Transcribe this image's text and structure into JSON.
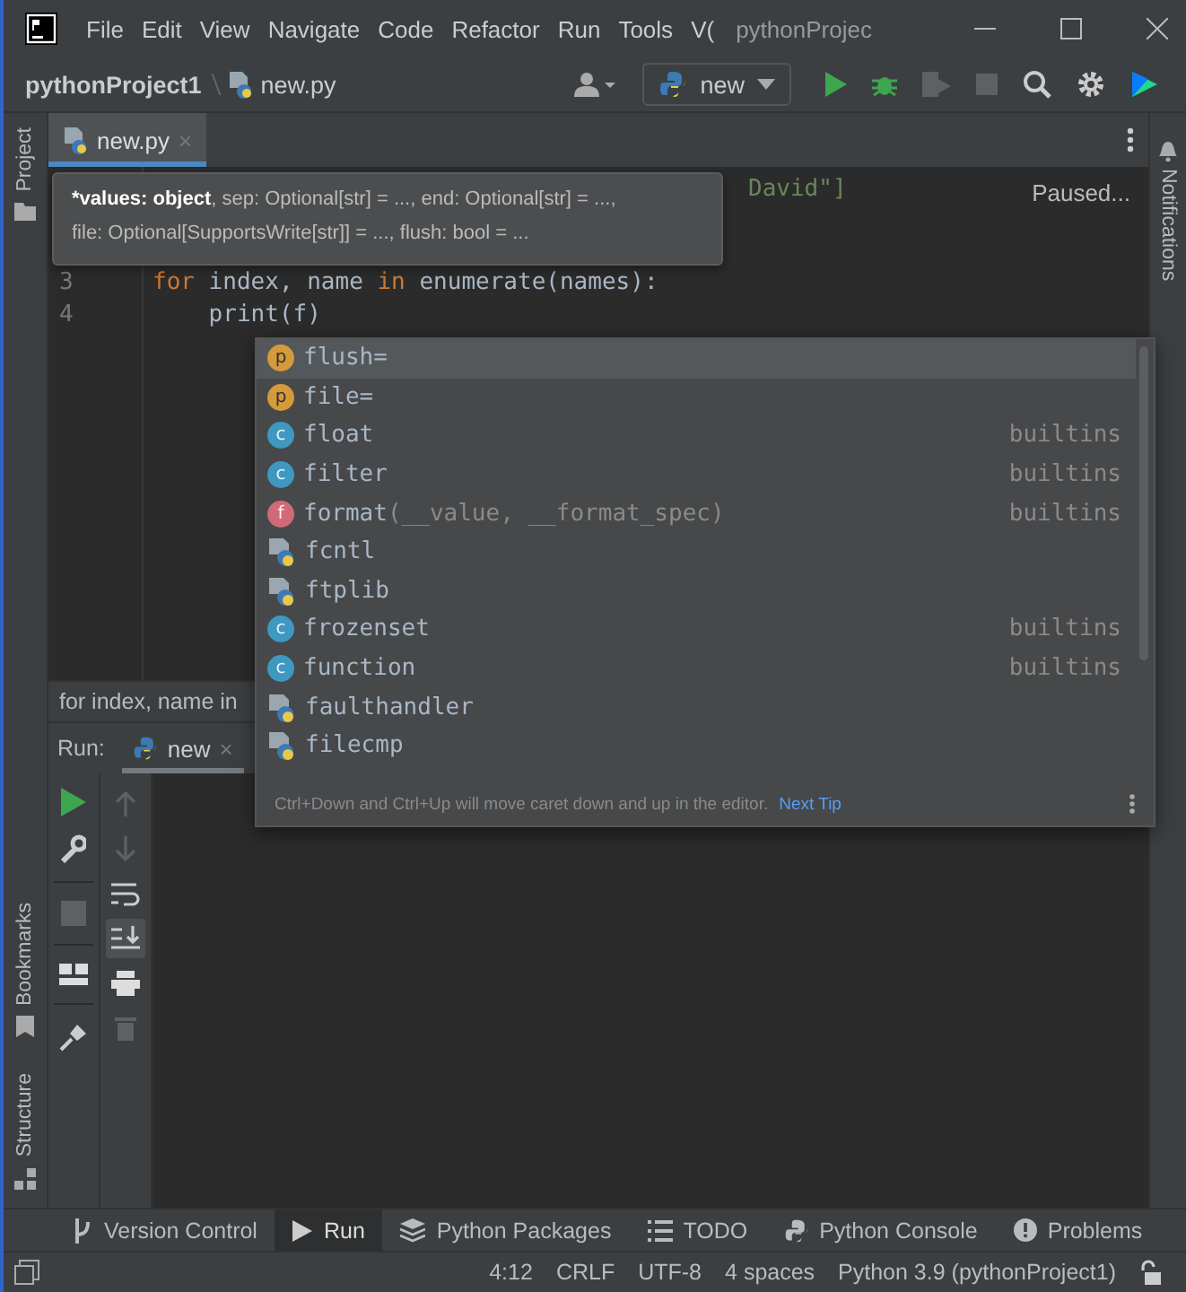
{
  "menu": {
    "items": [
      "File",
      "Edit",
      "View",
      "Navigate",
      "Code",
      "Refactor",
      "Run",
      "Tools",
      "V("
    ]
  },
  "window": {
    "title": "pythonProjec"
  },
  "breadcrumb": [
    "pythonProject1",
    "new.py"
  ],
  "run_config": {
    "label": "new"
  },
  "toolbar": [
    {
      "kind": "run",
      "disabled": false
    },
    {
      "kind": "debug",
      "disabled": false
    },
    {
      "kind": "coverage",
      "disabled": true
    },
    {
      "kind": "stop",
      "disabled": true
    }
  ],
  "left_strip": {
    "top": "Project",
    "bottom": [
      "Bookmarks",
      "Structure"
    ]
  },
  "right_strip": {
    "label": "Notifications"
  },
  "editor_tabs": [
    {
      "label": "new.py",
      "close": "×",
      "selected": true
    }
  ],
  "editor": {
    "status": "Paused...",
    "lines": [
      {
        "segments": [
          {
            "text": "David\"]",
            "kind": "string"
          }
        ]
      },
      {
        "number": "3",
        "segments": [
          {
            "text": "for",
            "kind": "keyword"
          },
          {
            "text": " index, name ",
            "kind": "plain"
          },
          {
            "text": "in",
            "kind": "keyword"
          },
          {
            "text": " enumerate(names):",
            "kind": "plain"
          }
        ]
      },
      {
        "number": "4",
        "segments": [
          {
            "text": "    print(f)",
            "kind": "plain"
          }
        ]
      }
    ],
    "breadcrumb": "for index, name in"
  },
  "tooltip": {
    "lines": [
      [
        {
          "text": "*values: object",
          "bold": true
        },
        {
          "text": ", sep: Optional[str] = ..., end: Optional[str] = ...,",
          "bold": false
        }
      ],
      [
        {
          "text": "file: Optional[SupportsWrite[str]] = ..., flush: bool = ...",
          "bold": false
        }
      ]
    ]
  },
  "completion": {
    "items": [
      {
        "kind": "parameter",
        "letter": "p",
        "name": "flush=",
        "selected": true
      },
      {
        "kind": "parameter",
        "letter": "p",
        "name": "file=",
        "selected": false
      },
      {
        "kind": "class",
        "letter": "c",
        "name": "float",
        "source": "builtins",
        "selected": false
      },
      {
        "kind": "class",
        "letter": "c",
        "name": "filter",
        "source": "builtins",
        "selected": false
      },
      {
        "kind": "function",
        "letter": "f",
        "name": "format",
        "args": "(__value, __format_spec)",
        "source": "builtins",
        "selected": false
      },
      {
        "kind": "module",
        "name": "fcntl",
        "selected": false
      },
      {
        "kind": "module",
        "name": "ftplib",
        "selected": false
      },
      {
        "kind": "class",
        "letter": "c",
        "name": "frozenset",
        "source": "builtins",
        "selected": false
      },
      {
        "kind": "class",
        "letter": "c",
        "name": "function",
        "source": "builtins",
        "selected": false
      },
      {
        "kind": "module",
        "name": "faulthandler",
        "selected": false
      },
      {
        "kind": "module",
        "name": "filecmp",
        "selected": false
      }
    ],
    "hint": "Ctrl+Down and Ctrl+Up will move caret down and up in the editor.",
    "hint_link": "Next Tip"
  },
  "run_panel": {
    "title": "Run:",
    "tab": "new",
    "close": "×",
    "left_tools": [
      {
        "kind": "run",
        "disabled": false
      },
      {
        "kind": "wrench",
        "disabled": false
      },
      {
        "kind": "stop",
        "disabled": true
      },
      {
        "kind": "layout",
        "disabled": false
      },
      {
        "kind": "pin",
        "disabled": false
      }
    ],
    "right_tools": [
      {
        "kind": "up",
        "disabled": true,
        "selected": false
      },
      {
        "kind": "down",
        "disabled": true,
        "selected": false
      },
      {
        "kind": "wrap",
        "disabled": false,
        "selected": false
      },
      {
        "kind": "scroll-end",
        "disabled": false,
        "selected": true
      },
      {
        "kind": "print",
        "disabled": false,
        "selected": false
      },
      {
        "kind": "trash",
        "disabled": true,
        "selected": false
      }
    ]
  },
  "tool_windows": [
    {
      "kind": "vcs",
      "label": "Version Control",
      "selected": false
    },
    {
      "kind": "run",
      "label": "Run",
      "selected": true
    },
    {
      "kind": "packages",
      "label": "Python Packages",
      "selected": false
    },
    {
      "kind": "todo",
      "label": "TODO",
      "selected": false
    },
    {
      "kind": "console",
      "label": "Python Console",
      "selected": false
    },
    {
      "kind": "problems",
      "label": "Problems",
      "selected": false
    }
  ],
  "status_bar": {
    "items": [
      "4:12",
      "CRLF",
      "UTF-8",
      "4 spaces",
      "Python 3.9 (pythonProject1)"
    ]
  }
}
